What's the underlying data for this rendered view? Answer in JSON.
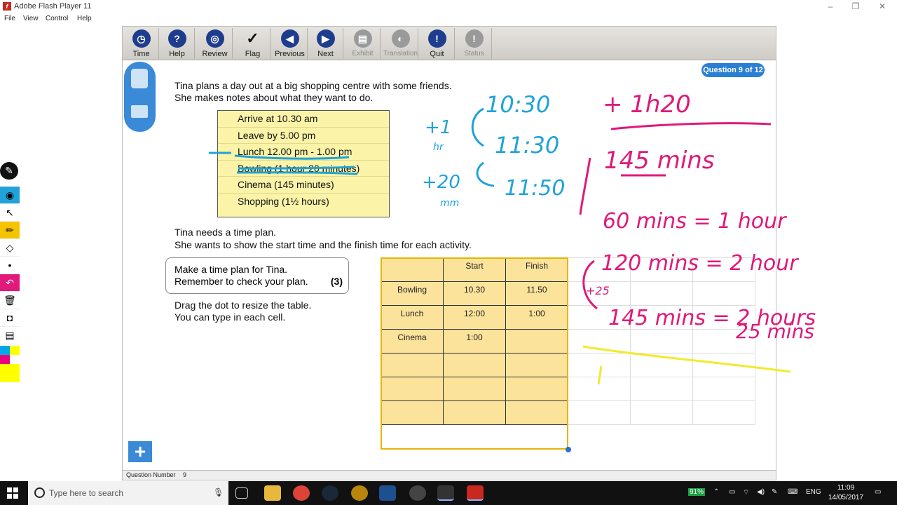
{
  "window": {
    "title": "Adobe Flash Player 11",
    "menu": [
      "File",
      "View",
      "Control",
      "Help"
    ],
    "controls": {
      "minimize": "–",
      "restore": "❐",
      "close": "✕"
    }
  },
  "toolbar": {
    "buttons": [
      {
        "label": "Time",
        "icon": "clock-icon",
        "glyph": "◷"
      },
      {
        "label": "Help",
        "icon": "help-icon",
        "glyph": "?"
      },
      {
        "label": "Review",
        "icon": "review-icon",
        "glyph": "◎"
      },
      {
        "label": "Flag",
        "icon": "flag-check-icon",
        "glyph": "✓"
      },
      {
        "label": "Previous",
        "icon": "arrow-left-icon",
        "glyph": "◀"
      },
      {
        "label": "Next",
        "icon": "arrow-right-icon",
        "glyph": "▶"
      },
      {
        "label": "Exhibit",
        "icon": "exhibit-icon",
        "glyph": "▤"
      },
      {
        "label": "Translation",
        "icon": "translation-icon",
        "glyph": "◐"
      },
      {
        "label": "Quit",
        "icon": "quit-warning-icon",
        "glyph": "!"
      },
      {
        "label": "Status",
        "icon": "status-warning-icon",
        "glyph": "!"
      }
    ]
  },
  "question_badge": "Question 9 of 12",
  "intro": {
    "line1": "Tina plans a day out at a big shopping centre with some friends.",
    "line2": "She makes notes about what they want to do."
  },
  "notes": [
    "Arrive at 10.30 am",
    "Leave by 5.00 pm",
    "Lunch 12.00 pm - 1.00 pm",
    "Bowling (1 hour 20 minutes)",
    "Cinema (145 minutes)",
    "Shopping (1½ hours)"
  ],
  "instruction": {
    "line1": "Tina needs a time plan.",
    "line2": "She wants to show the start time and the finish time for each activity."
  },
  "task": {
    "line1": "Make a time plan for Tina.",
    "line2": "Remember to check your plan.",
    "marks": "(3)"
  },
  "drag_hint": {
    "line1": "Drag the dot to resize the table.",
    "line2": "You can type in each cell."
  },
  "plan_table": {
    "header": [
      "",
      "Start",
      "Finish"
    ],
    "rows": [
      [
        "Bowling",
        "10.30",
        "11.50"
      ],
      [
        "Lunch",
        "12:00",
        "1:00"
      ],
      [
        "Cinema",
        "1:00",
        ""
      ],
      [
        "",
        "",
        ""
      ],
      [
        "",
        "",
        ""
      ],
      [
        "",
        "",
        ""
      ]
    ]
  },
  "question_number": {
    "label": "Question Number",
    "value": "9"
  },
  "annotations": {
    "blue": [
      "10:30",
      "+1",
      "hr",
      "11:30",
      "+20",
      "mm",
      "11:50"
    ],
    "pink": [
      "+ 1h20",
      "145 mins",
      "60 mins = 1 hour",
      "120 mins = 2 hour",
      "+25",
      "145 mins = 2 hours",
      "25 mins"
    ]
  },
  "left_tools": [
    {
      "icon": "pen-logo-icon",
      "glyph": "✎"
    },
    {
      "icon": "eye-icon",
      "glyph": "◉"
    },
    {
      "icon": "pointer-icon",
      "glyph": "↖"
    },
    {
      "icon": "pencil-icon",
      "glyph": "✏"
    },
    {
      "icon": "eraser-icon",
      "glyph": "◇"
    },
    {
      "icon": "dot-size-icon",
      "glyph": "•"
    },
    {
      "icon": "undo-icon",
      "glyph": "↶"
    },
    {
      "icon": "trash-icon",
      "glyph": "🗑"
    },
    {
      "icon": "camera-icon",
      "glyph": "◘"
    },
    {
      "icon": "page-icon",
      "glyph": "▤"
    }
  ],
  "palette": [
    "#00a8e8",
    "#ffff00",
    "#e8007a",
    "#ffff00"
  ],
  "taskbar": {
    "search_placeholder": "Type here to search",
    "battery": "91%",
    "language": "ENG",
    "time": "11:09",
    "date": "14/05/2017"
  }
}
